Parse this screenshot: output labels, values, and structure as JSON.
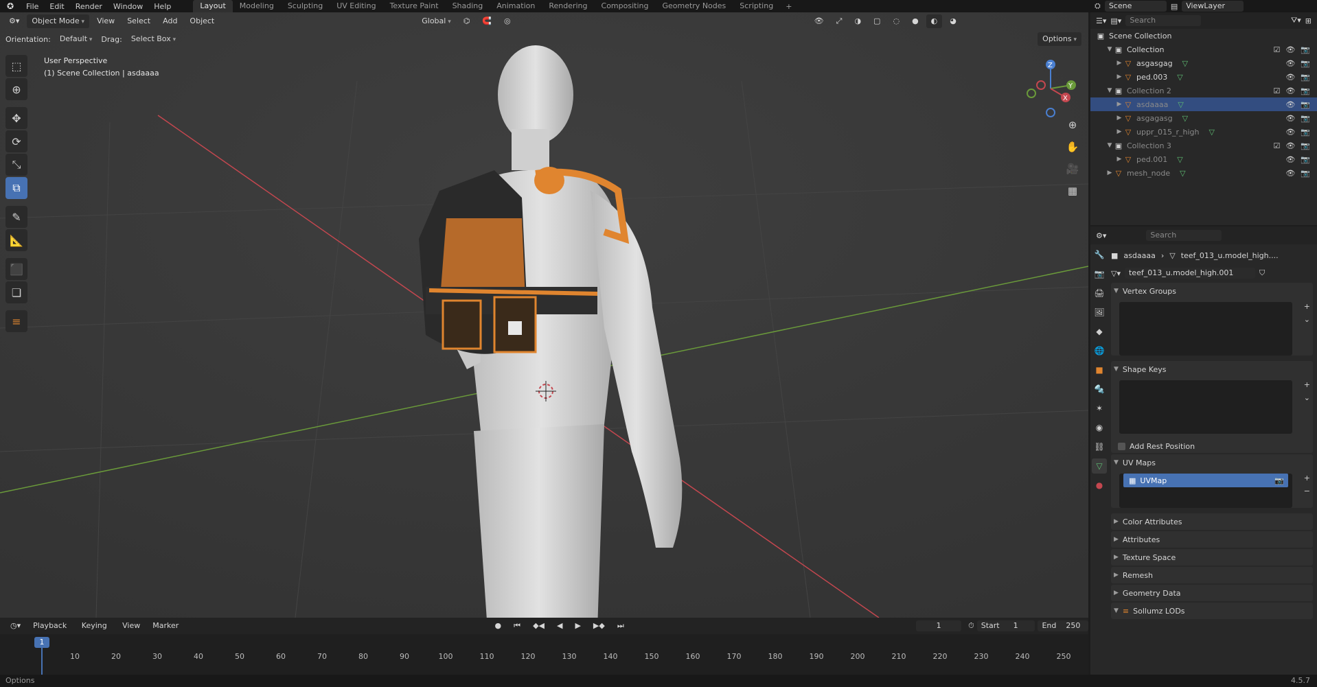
{
  "topbar": {
    "menus": [
      "File",
      "Edit",
      "Render",
      "Window",
      "Help"
    ],
    "workspaces": [
      "Layout",
      "Modeling",
      "Sculpting",
      "UV Editing",
      "Texture Paint",
      "Shading",
      "Animation",
      "Rendering",
      "Compositing",
      "Geometry Nodes",
      "Scripting"
    ],
    "active_workspace": "Layout",
    "scene": "Scene",
    "view_layer": "ViewLayer"
  },
  "viewport": {
    "mode": "Object Mode",
    "menus": [
      "View",
      "Select",
      "Add",
      "Object"
    ],
    "transform_orientation": "Global",
    "orientation_label": "Orientation:",
    "orientation_value": "Default",
    "drag_label": "Drag:",
    "drag_value": "Select Box",
    "options_label": "Options",
    "info_line1": "User Perspective",
    "info_line2": "(1) Scene Collection | asdaaaa",
    "gizmo_axes": {
      "x": "X",
      "y": "Y",
      "z": "Z"
    }
  },
  "outliner": {
    "search_placeholder": "Search",
    "root": "Scene Collection",
    "rows": [
      {
        "label": "Collection",
        "indent": 1,
        "type": "collection",
        "dim": false,
        "selected": false
      },
      {
        "label": "asgasgag",
        "indent": 2,
        "type": "object",
        "dim": false,
        "selected": false
      },
      {
        "label": "ped.003",
        "indent": 2,
        "type": "object",
        "dim": false,
        "selected": false
      },
      {
        "label": "Collection 2",
        "indent": 1,
        "type": "collection",
        "dim": true,
        "selected": false
      },
      {
        "label": "asdaaaa",
        "indent": 2,
        "type": "object",
        "dim": true,
        "selected": true
      },
      {
        "label": "asgagasg",
        "indent": 2,
        "type": "object",
        "dim": true,
        "selected": false
      },
      {
        "label": "uppr_015_r_high",
        "indent": 2,
        "type": "object",
        "dim": true,
        "selected": false
      },
      {
        "label": "Collection 3",
        "indent": 1,
        "type": "collection",
        "dim": true,
        "selected": false
      },
      {
        "label": "ped.001",
        "indent": 2,
        "type": "object",
        "dim": true,
        "selected": false
      },
      {
        "label": "mesh_node",
        "indent": 1,
        "type": "object",
        "dim": true,
        "selected": false
      }
    ]
  },
  "properties": {
    "search_placeholder": "Search",
    "breadcrumb_object": "asdaaaa",
    "breadcrumb_data": "teef_013_u.model_high....",
    "mesh_name": "teef_013_u.model_high.001",
    "panels": {
      "vertex_groups": "Vertex Groups",
      "shape_keys": "Shape Keys",
      "add_rest_position": "Add Rest Position",
      "uv_maps": "UV Maps",
      "uv_map_item": "UVMap",
      "color_attributes": "Color Attributes",
      "attributes": "Attributes",
      "texture_space": "Texture Space",
      "remesh": "Remesh",
      "geometry_data": "Geometry Data",
      "sollumz_lods": "Sollumz LODs"
    }
  },
  "timeline": {
    "menus": [
      "Playback",
      "Keying",
      "View",
      "Marker"
    ],
    "current_frame": "1",
    "start_label": "Start",
    "start": "1",
    "end_label": "End",
    "end": "250",
    "ticks": [
      "10",
      "20",
      "30",
      "40",
      "50",
      "60",
      "70",
      "80",
      "90",
      "100",
      "110",
      "120",
      "130",
      "140",
      "150",
      "160",
      "170",
      "180",
      "190",
      "200",
      "210",
      "220",
      "230",
      "240",
      "250"
    ],
    "playhead": "1"
  },
  "statusbar": {
    "left": "Options",
    "version": "4.5.7"
  },
  "colors": {
    "accent": "#4772b3",
    "x_axis": "#c4474f",
    "y_axis": "#6a9a3a",
    "z_axis": "#4a7fd0",
    "vest": "#e0852f"
  }
}
